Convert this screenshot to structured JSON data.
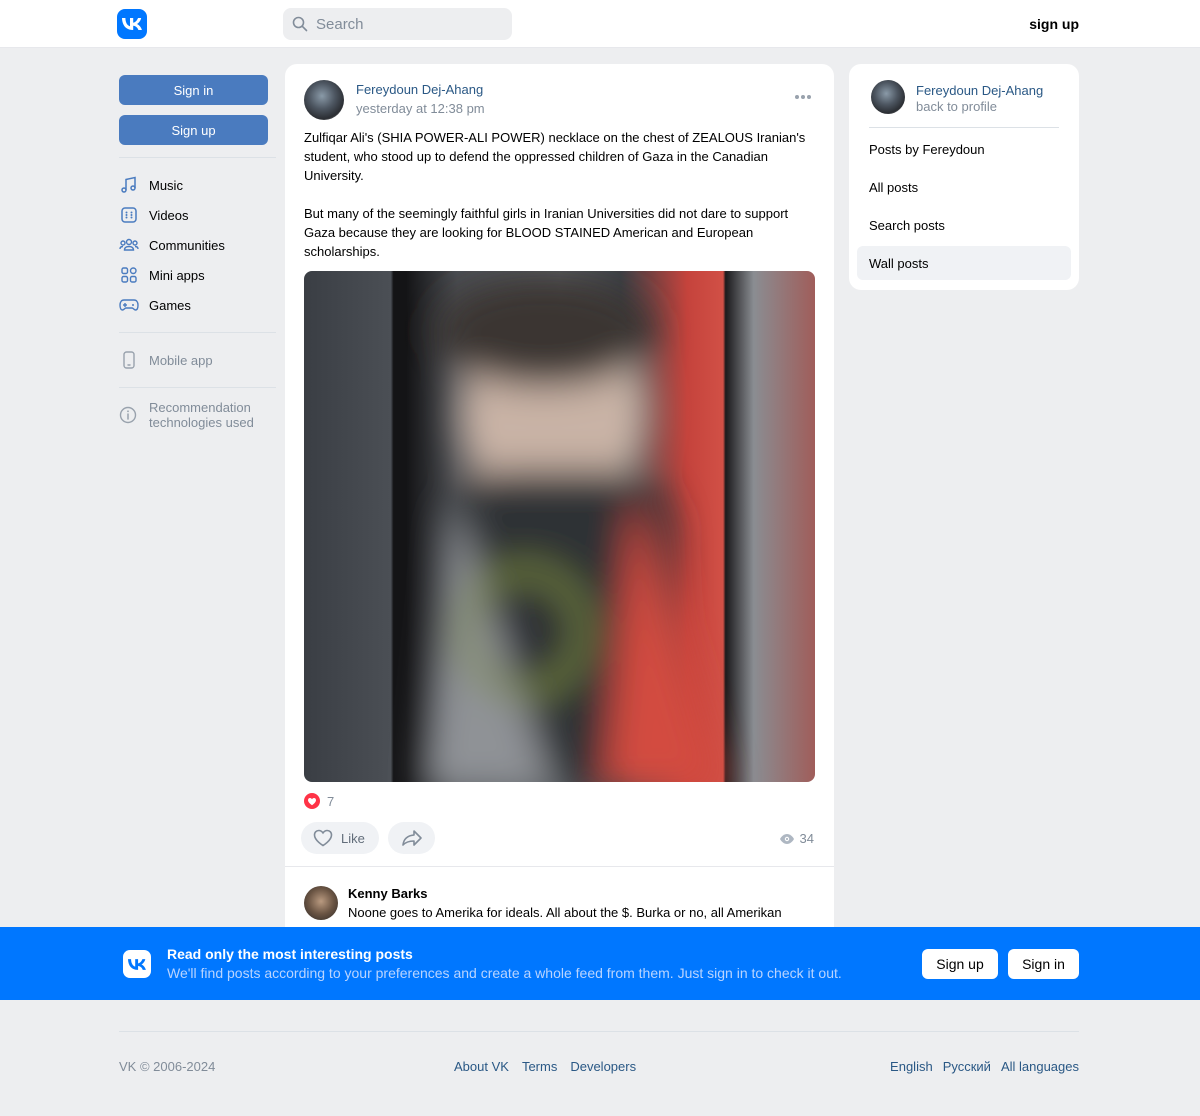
{
  "header": {
    "search_placeholder": "Search",
    "signup_label": "sign up"
  },
  "left_nav": {
    "signin_label": "Sign in",
    "signup_label": "Sign up",
    "items": [
      {
        "label": "Music",
        "icon": "music-icon"
      },
      {
        "label": "Videos",
        "icon": "videos-icon"
      },
      {
        "label": "Communities",
        "icon": "communities-icon"
      },
      {
        "label": "Mini apps",
        "icon": "mini-apps-icon"
      },
      {
        "label": "Games",
        "icon": "games-icon"
      }
    ],
    "mobile_app_label": "Mobile app",
    "recommendation_label": "Recommendation technologies used"
  },
  "post": {
    "author": "Fereydoun Dej-Ahang",
    "time": "yesterday at 12:38 pm",
    "text": "Zulfiqar Ali's (SHIA POWER-ALI POWER) necklace on the chest of ZEALOUS Iranian's student, who stood up to defend the oppressed children of Gaza in the Canadian University.\n\nBut many of the seemingly faithful girls in Iranian Universities did not dare to support Gaza because they are looking for BLOOD STAINED American and European scholarships.",
    "reactions_count": "7",
    "like_label": "Like",
    "views_count": "34",
    "comment": {
      "author": "Kenny Barks",
      "text": "Noone goes to Amerika for ideals. All about the $. Burka or no, all Amerikan"
    }
  },
  "right_card": {
    "name": "Fereydoun Dej-Ahang",
    "back_label": "back to profile",
    "menu": [
      {
        "label": "Posts by Fereydoun",
        "active": false
      },
      {
        "label": "All posts",
        "active": false
      },
      {
        "label": "Search posts",
        "active": false
      },
      {
        "label": "Wall posts",
        "active": true
      }
    ]
  },
  "banner": {
    "title": "Read only the most interesting posts",
    "subtitle": "We'll find posts according to your preferences and create a whole feed from them. Just sign in to check it out.",
    "signup_label": "Sign up",
    "signin_label": "Sign in"
  },
  "footer": {
    "copyright": "VK © 2006-2024",
    "links": [
      "About VK",
      "Terms",
      "Developers"
    ],
    "languages": [
      "English",
      "Русский",
      "All languages"
    ]
  },
  "colors": {
    "brand": "#0077ff",
    "link": "#2a5885",
    "muted": "#818c99",
    "button": "#4a7bbf",
    "background": "#edeef0"
  }
}
